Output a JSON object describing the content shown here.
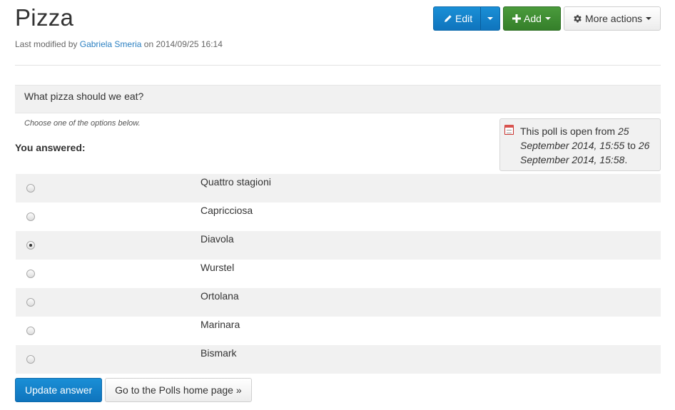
{
  "page": {
    "title": "Pizza",
    "byline_prefix": "Last modified by",
    "author": "Gabriela Smeria",
    "byline_on": "on",
    "modified": "2014/09/25 16:14"
  },
  "toolbar": {
    "edit_label": "Edit",
    "add_label": "Add",
    "more_label": "More actions",
    "edit_icon": "pencil-icon",
    "add_icon": "plus-icon",
    "more_icon": "gear-icon"
  },
  "poll": {
    "question": "What pizza should we eat?",
    "hint": "Choose one of the options below.",
    "answered_label": "You answered:",
    "status_prefix": "This poll is open from",
    "open_from": "25 September 2014, 15:55",
    "status_to": "to",
    "open_to": "26 September 2014, 15:58",
    "status_suffix": ".",
    "options": [
      {
        "label": "Quattro stagioni",
        "checked": false
      },
      {
        "label": "Capricciosa",
        "checked": false
      },
      {
        "label": "Diavola",
        "checked": true
      },
      {
        "label": "Wurstel",
        "checked": false
      },
      {
        "label": "Ortolana",
        "checked": false
      },
      {
        "label": "Marinara",
        "checked": false
      },
      {
        "label": "Bismark",
        "checked": false
      }
    ]
  },
  "actions": {
    "update_label": "Update answer",
    "home_label": "Go to the Polls home page »"
  },
  "colors": {
    "primary": "#1a8fd6",
    "success": "#4a9b3c",
    "link": "#2a7fc1"
  }
}
